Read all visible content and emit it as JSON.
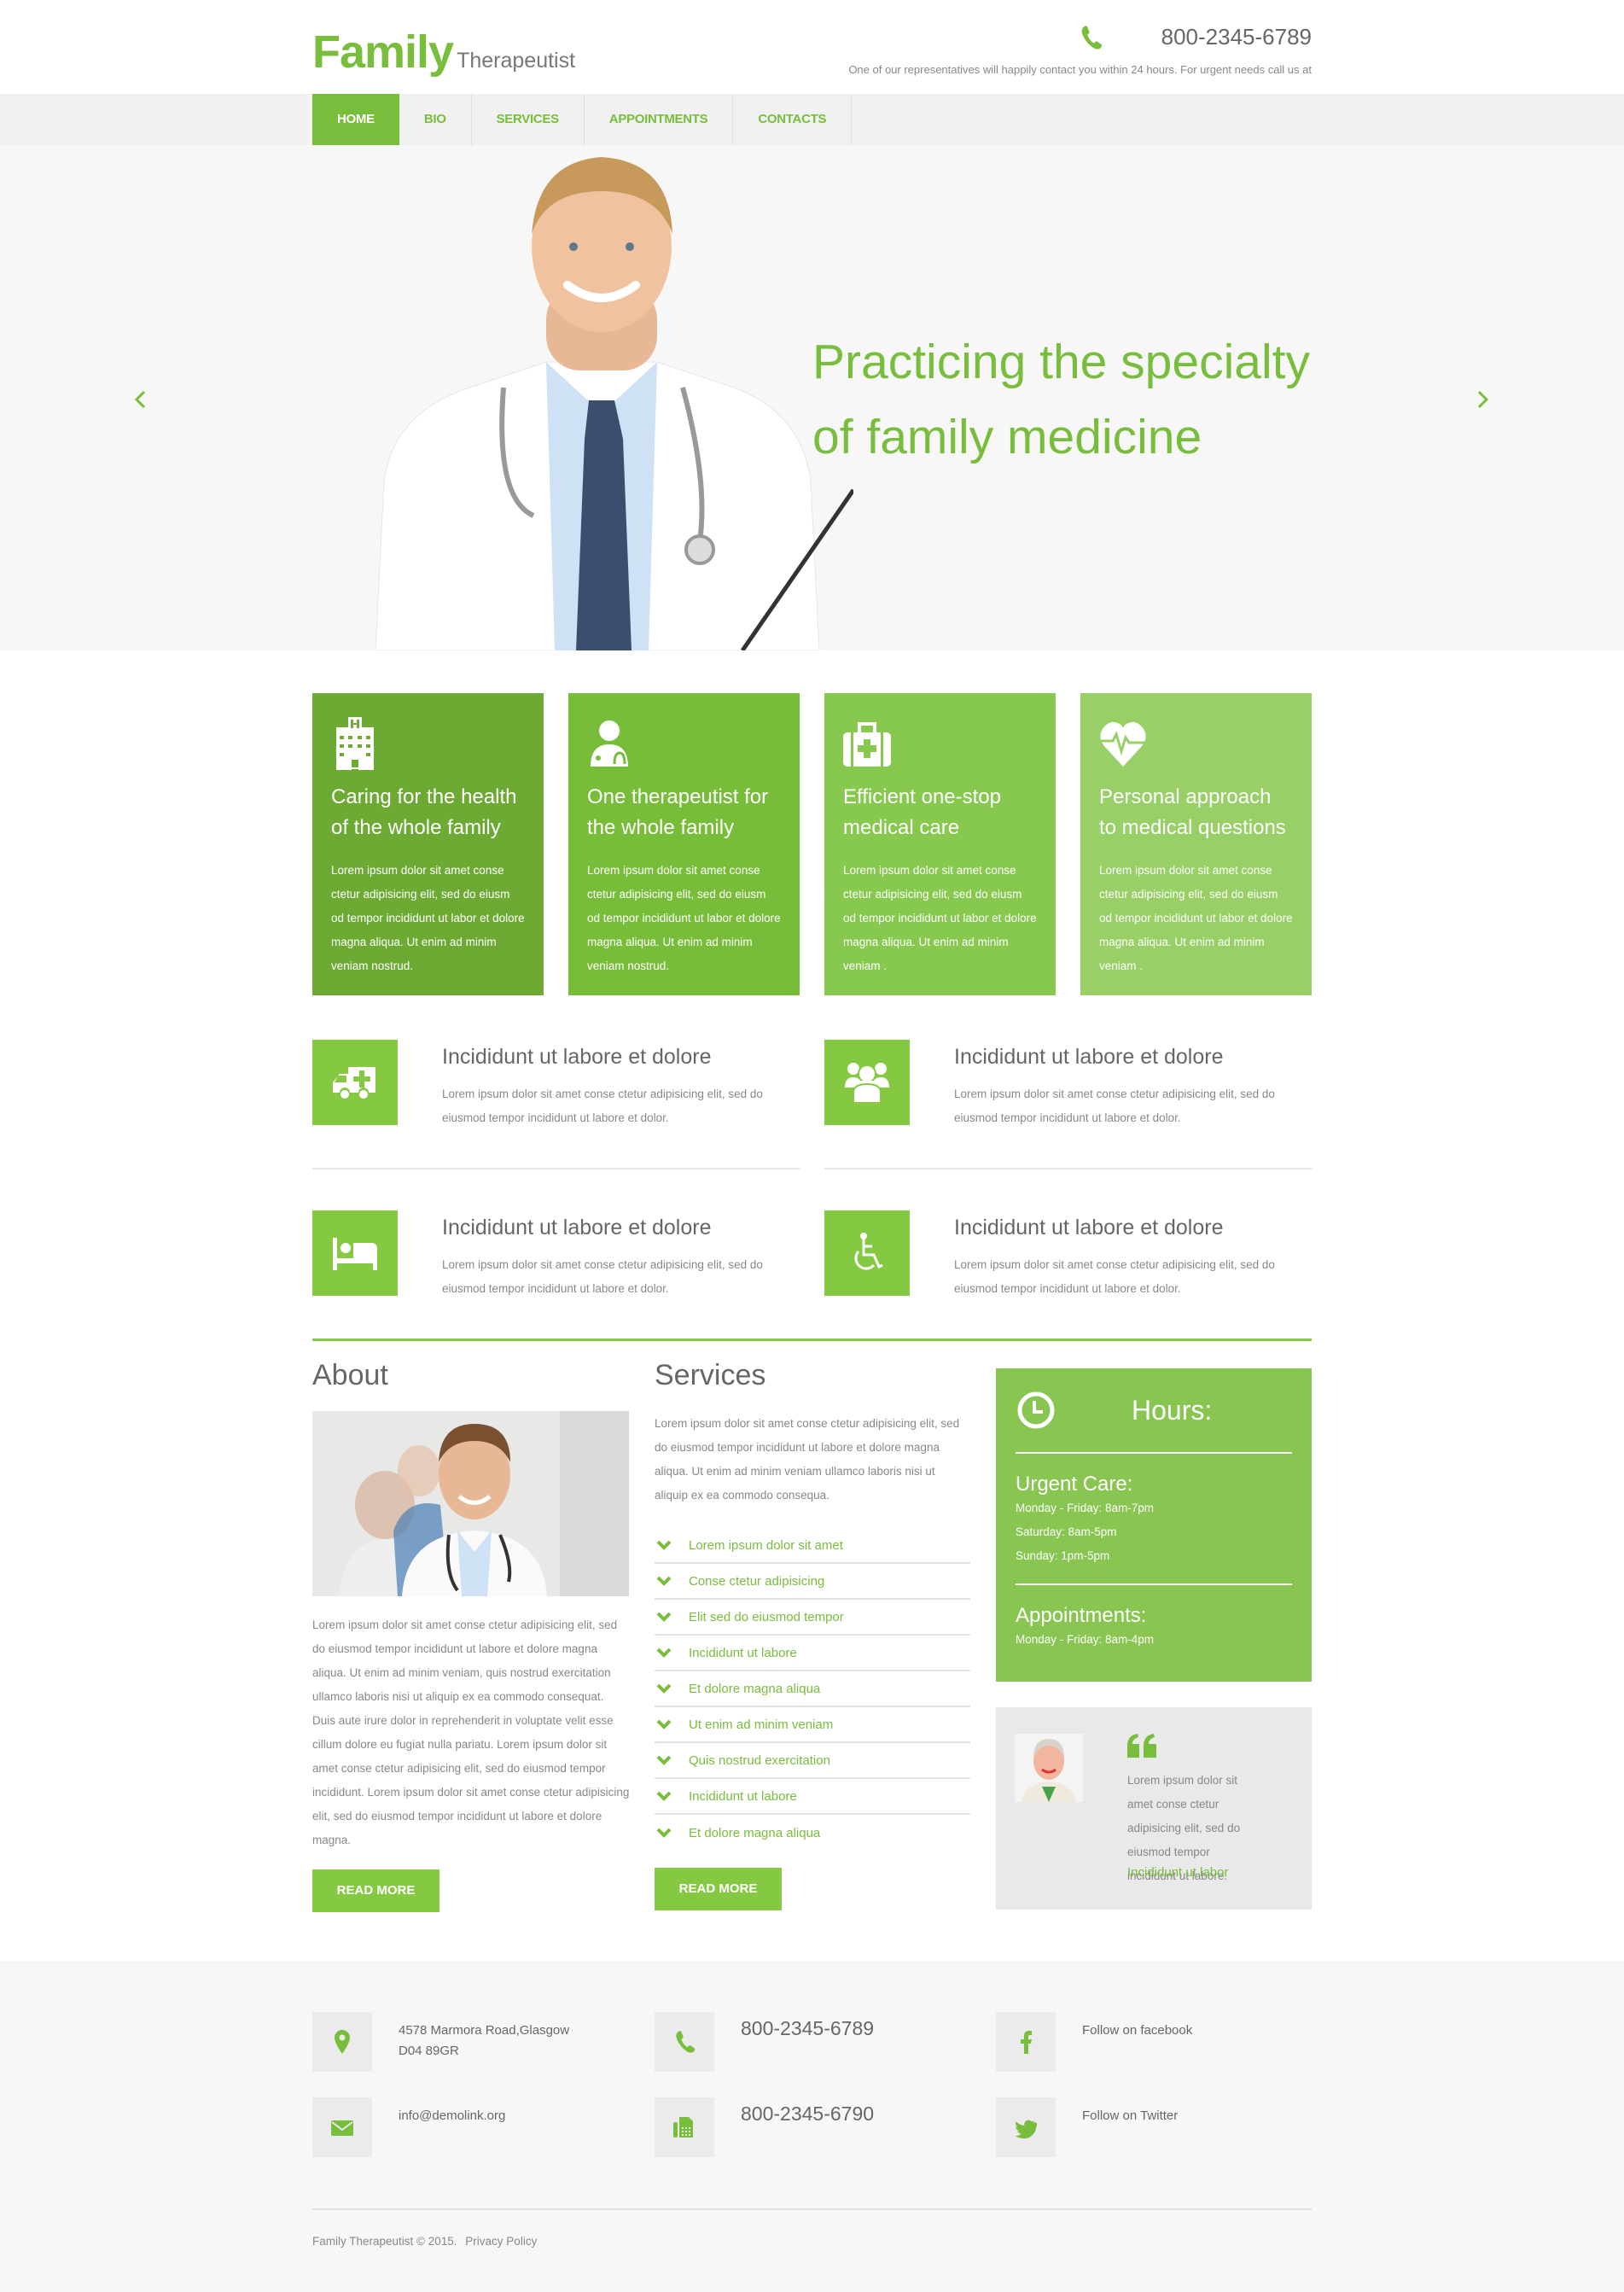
{
  "header": {
    "logo_main": "Family",
    "logo_sub": "Therapeutist",
    "phone": "800-2345-6789",
    "tagline": "One of our representatives will happily contact you within 24 hours. For urgent needs call us at",
    "phone_icon": "phone-icon"
  },
  "nav": {
    "items": [
      {
        "label": "HOME",
        "active": true
      },
      {
        "label": "BIO",
        "active": false
      },
      {
        "label": "SERVICES",
        "active": false
      },
      {
        "label": "APPOINTMENTS",
        "active": false
      },
      {
        "label": "CONTACTS",
        "active": false
      }
    ]
  },
  "hero": {
    "title_line1": "Practicing the specialty",
    "title_line2": "of family medicine",
    "prev_icon": "chevron-left-icon",
    "next_icon": "chevron-right-icon"
  },
  "cards": [
    {
      "icon": "hospital-icon",
      "title": "Caring for the health of the whole family",
      "text": "Lorem ipsum dolor sit amet conse ctetur adipisicing elit, sed do eiusm od tempor incididunt ut labor et dolore magna aliqua. Ut enim ad minim veniam  nostrud.",
      "color": "#6daa34"
    },
    {
      "icon": "doctor-icon",
      "title": "One therapeutist for the whole family",
      "text": "Lorem ipsum dolor sit amet conse ctetur adipisicing elit, sed do eiusm od tempor incididunt ut labor et dolore magna aliqua. Ut enim ad minim veniam  nostrud.",
      "color": "#78bd3a"
    },
    {
      "icon": "medkit-icon",
      "title": "Efficient one-stop medical care",
      "text": "Lorem ipsum dolor sit amet conse ctetur adipisicing elit, sed do eiusm od tempor incididunt ut labor et dolore magna aliqua. Ut enim ad minim veniam .",
      "color": "#87c84e"
    },
    {
      "icon": "heartbeat-icon",
      "title": "Personal approach to medical questions",
      "text": "Lorem ipsum dolor sit amet conse ctetur adipisicing elit, sed do eiusm od tempor incididunt ut labor et dolore magna aliqua. Ut enim ad minim veniam .",
      "color": "#98cf66"
    }
  ],
  "features": [
    {
      "icon": "ambulance-icon",
      "title": "Incididunt ut labore et dolore",
      "text": "Lorem ipsum dolor sit amet conse ctetur adipisicing elit, sed do eiusmod tempor incididunt ut labore et dolor."
    },
    {
      "icon": "users-icon",
      "title": "Incididunt ut labore et dolore",
      "text": "Lorem ipsum dolor sit amet conse ctetur adipisicing elit, sed do eiusmod tempor incididunt ut labore et dolor."
    },
    {
      "icon": "bed-icon",
      "title": "Incididunt ut labore et dolore",
      "text": "Lorem ipsum dolor sit amet conse ctetur adipisicing elit, sed do eiusmod tempor incididunt ut labore et dolor."
    },
    {
      "icon": "wheelchair-icon",
      "title": "Incididunt ut labore et dolore",
      "text": "Lorem ipsum dolor sit amet conse ctetur adipisicing elit, sed do eiusmod tempor incididunt ut labore et dolor."
    }
  ],
  "about": {
    "title": "About",
    "text": "Lorem ipsum dolor sit amet conse ctetur adipisicing elit, sed do eiusmod tempor incididunt ut labore et dolore magna aliqua. Ut enim ad minim veniam, quis nostrud exercitation ullamco laboris nisi ut aliquip ex ea commodo consequat. Duis aute irure dolor in reprehenderit in voluptate velit esse cillum dolore eu fugiat nulla pariatu. Lorem ipsum dolor sit amet conse ctetur adipisicing elit, sed do eiusmod tempor incididunt. Lorem ipsum dolor sit amet conse ctetur adipisicing elit, sed do eiusmod tempor incididunt ut labore et dolore magna.",
    "button": "READ MORE"
  },
  "services": {
    "title": "Services",
    "text": "Lorem ipsum dolor sit amet conse ctetur adipisicing elit, sed do eiusmod tempor incididunt ut labore et dolore magna aliqua. Ut enim ad minim veniam ullamco laboris nisi ut aliquip ex ea commodo consequa.",
    "items": [
      "Lorem ipsum dolor sit amet",
      "Conse ctetur adipisicing",
      "Elit sed do eiusmod tempor",
      "Incididunt ut labore",
      "Et dolore magna aliqua",
      "Ut enim ad minim veniam",
      "Quis nostrud exercitation",
      "Incididunt ut labore",
      "Et dolore magna aliqua"
    ],
    "button": "READ MORE"
  },
  "hours": {
    "title": "Hours:",
    "urgent_title": "Urgent Care:",
    "urgent_lines": [
      "Monday - Friday: 8am-7pm",
      "Saturday: 8am-5pm",
      "Sunday: 1pm-5pm"
    ],
    "appt_title": "Appointments:",
    "appt_lines": [
      "Monday - Friday: 8am-4pm"
    ]
  },
  "testimonial": {
    "text": "Lorem ipsum dolor sit amet conse ctetur adipisicing elit, sed do eiusmod tempor incididunt ut labore.",
    "link": "Incididunt ut labor"
  },
  "footer": {
    "address_line1": "4578 Marmora Road,Glasgow",
    "address_line2": "D04 89GR",
    "email": "info@demolink.org",
    "phone": "800-2345-6789",
    "fax": "800-2345-6790",
    "facebook": "Follow on facebook",
    "twitter": "Follow on Twitter",
    "copyright": "Family Therapeutist © 2015.",
    "privacy": "Privacy Policy"
  },
  "colors": {
    "accent": "#78bd3c",
    "button": "#85c942",
    "hours_bg": "#88c651"
  }
}
